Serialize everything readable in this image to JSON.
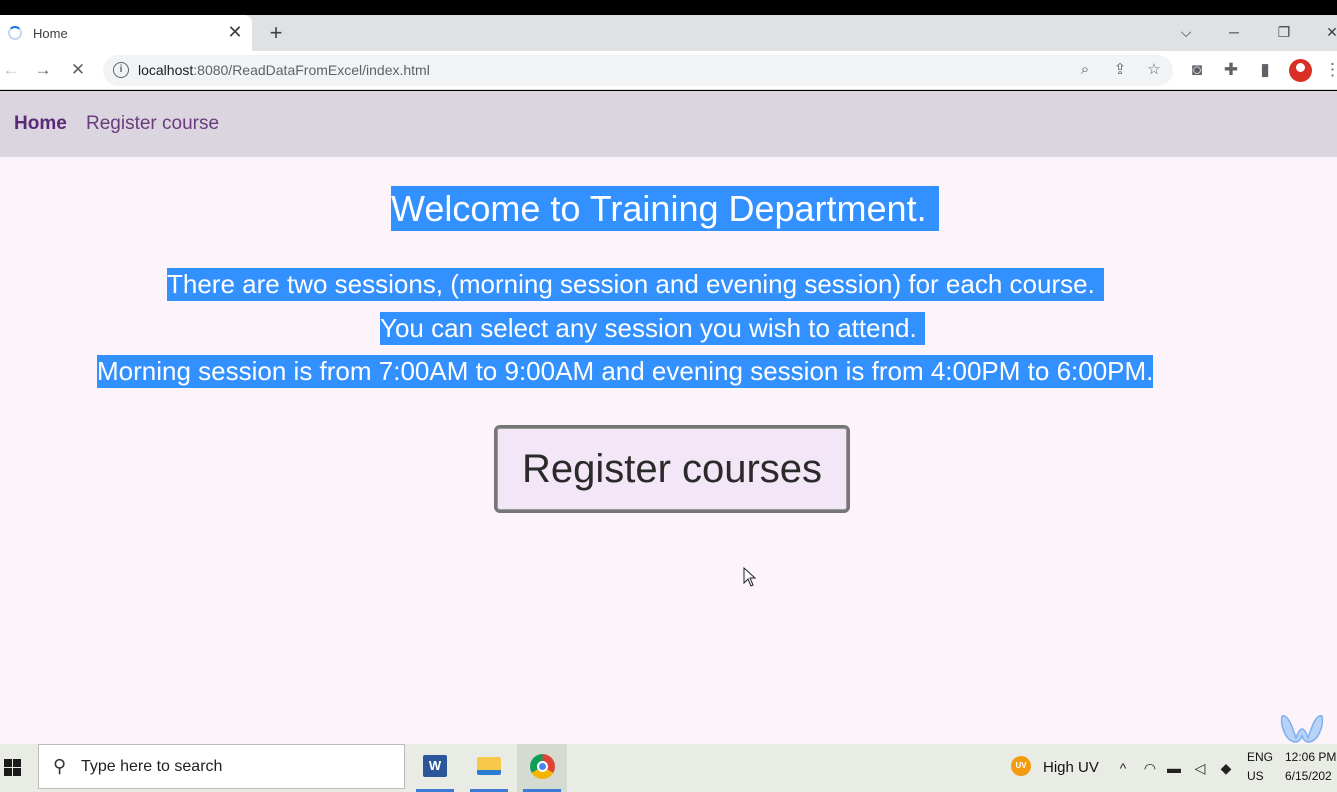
{
  "browser": {
    "tab_title": "Home",
    "new_tab_symbol": "+",
    "tab_close_symbol": "✕",
    "url_host": "localhost",
    "url_path": ":8080/ReadDataFromExcel/index.html"
  },
  "site": {
    "nav": [
      {
        "label": "Home",
        "active": true
      },
      {
        "label": "Register course",
        "active": false
      }
    ],
    "headline": "Welcome to Training Department.",
    "paragraph_lines": [
      "There are two sessions, (morning session and evening session) for each course.",
      "You can select any session you wish to attend.",
      "Morning session is from 7:00AM to 9:00AM and evening session is from 4:00PM to 6:00PM."
    ],
    "register_button": "Register courses",
    "selection_color": "#3390ff"
  },
  "taskbar": {
    "search_placeholder": "Type here to search",
    "weather": "High UV",
    "weather_icon_text": "UV",
    "lang_top": "ENG",
    "lang_bottom": "US",
    "time": "12:06 PM",
    "date": "6/15/202"
  },
  "icons": {
    "word": "W"
  }
}
